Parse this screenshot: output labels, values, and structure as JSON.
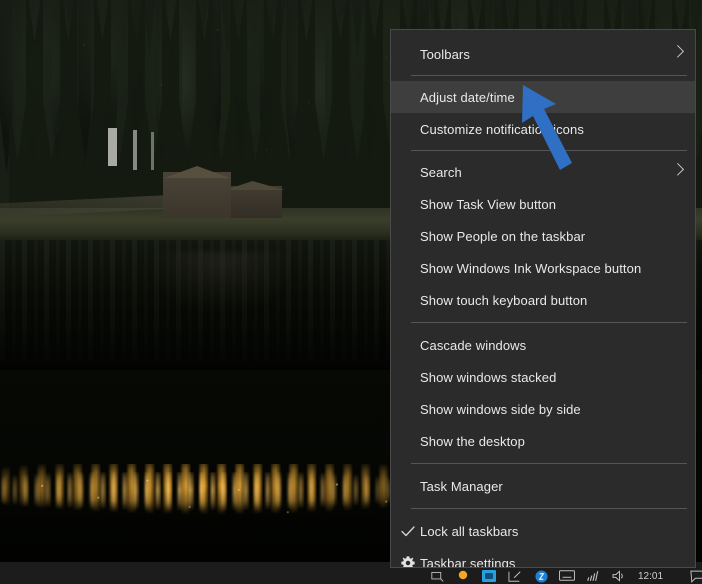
{
  "desktop": {
    "wallpaper_description": "Dark forest lake with wooden cabin and golden autumn reflections",
    "wallpaper_colors": {
      "forest": "#1b2216",
      "water": "#0a0d07",
      "cabin": "#4a4337",
      "gold_reflection": "#ecb03e"
    }
  },
  "taskbar": {
    "background_color": "#1c1c1c",
    "clock": "12:01",
    "tray_icons": [
      "display-icon",
      "orange-dot-icon",
      "blue-app-icon",
      "pen-icon",
      "blue-circle-icon",
      "keyboard-icon",
      "network-icon",
      "volume-icon",
      "action-center-icon"
    ]
  },
  "context_menu": {
    "background_color": "#2b2b2b",
    "highlight_color": "#3e3e3e",
    "text_color": "#e9e9e9",
    "border_color": "#4a4a4a",
    "groups": [
      {
        "items": [
          {
            "label": "Toolbars",
            "submenu": true,
            "gutter_icon": null,
            "highlighted": false
          }
        ]
      },
      {
        "items": [
          {
            "label": "Adjust date/time",
            "submenu": false,
            "gutter_icon": null,
            "highlighted": true
          },
          {
            "label": "Customize notification icons",
            "submenu": false,
            "gutter_icon": null,
            "highlighted": false
          }
        ]
      },
      {
        "items": [
          {
            "label": "Search",
            "submenu": true,
            "gutter_icon": null,
            "highlighted": false
          },
          {
            "label": "Show Task View button",
            "submenu": false,
            "gutter_icon": null,
            "highlighted": false
          },
          {
            "label": "Show People on the taskbar",
            "submenu": false,
            "gutter_icon": null,
            "highlighted": false
          },
          {
            "label": "Show Windows Ink Workspace button",
            "submenu": false,
            "gutter_icon": null,
            "highlighted": false
          },
          {
            "label": "Show touch keyboard button",
            "submenu": false,
            "gutter_icon": null,
            "highlighted": false
          }
        ]
      },
      {
        "items": [
          {
            "label": "Cascade windows",
            "submenu": false,
            "gutter_icon": null,
            "highlighted": false
          },
          {
            "label": "Show windows stacked",
            "submenu": false,
            "gutter_icon": null,
            "highlighted": false
          },
          {
            "label": "Show windows side by side",
            "submenu": false,
            "gutter_icon": null,
            "highlighted": false
          },
          {
            "label": "Show the desktop",
            "submenu": false,
            "gutter_icon": null,
            "highlighted": false
          }
        ]
      },
      {
        "items": [
          {
            "label": "Task Manager",
            "submenu": false,
            "gutter_icon": null,
            "highlighted": false
          }
        ]
      },
      {
        "items": [
          {
            "label": "Lock all taskbars",
            "submenu": false,
            "gutter_icon": "checkmark-icon",
            "highlighted": false
          },
          {
            "label": "Taskbar settings",
            "submenu": false,
            "gutter_icon": "gear-icon",
            "highlighted": false
          }
        ]
      }
    ]
  },
  "annotation": {
    "type": "arrow",
    "color": "#2f6fc4",
    "points_to": "Adjust date/time"
  }
}
